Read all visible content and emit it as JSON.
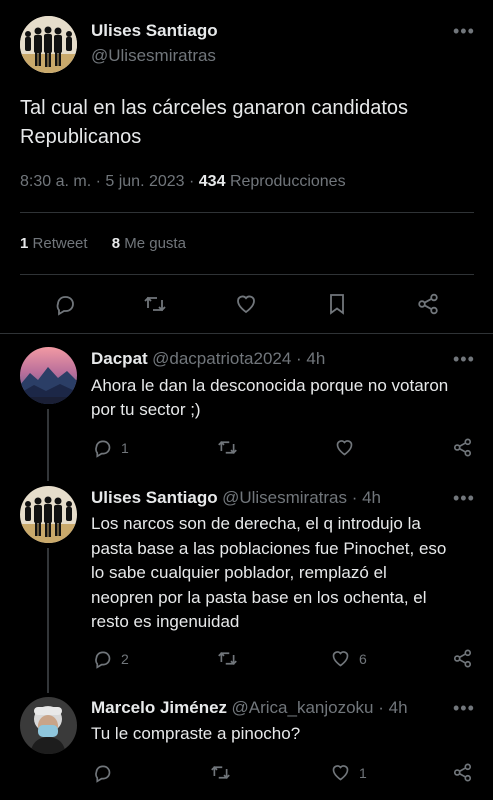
{
  "main_tweet": {
    "author_name": "Ulises Santiago",
    "author_handle": "@Ulisesmiratras",
    "text_line1": "Tal cual en las cárceles ganaron candidatos",
    "text_line2": "Republicanos",
    "time": "8:30 a. m. · 5 jun. 2023 ·",
    "views_count": "434",
    "views_label": "Reproducciones",
    "retweets_count": "1",
    "retweets_label": "Retweet",
    "likes_count": "8",
    "likes_label": "Me gusta"
  },
  "replies": [
    {
      "name": "Dacpat",
      "handle_time": "@dacpatriota2024 · 4h",
      "lines": [
        "Ahora le dan la desconocida porque no votaron",
        "por tu sector ;)"
      ],
      "reply_count": "1",
      "retweet_count": "",
      "like_count": ""
    },
    {
      "name": "Ulises Santiago",
      "handle_time": "@Ulisesmiratras · 4h",
      "lines": [
        "Los narcos son de derecha, el q introdujo la",
        "pasta base a las poblaciones fue Pinochet, eso",
        "lo sabe cualquier poblador, remplazó el",
        "neopren por la pasta base en los ochenta, el",
        "resto es ingenuidad"
      ],
      "reply_count": "2",
      "retweet_count": "",
      "like_count": "6"
    },
    {
      "name": "Marcelo Jiménez",
      "handle_time": "@Arica_kanjozoku · 4h",
      "lines": [
        "Tu le compraste a pinocho?"
      ],
      "reply_count": "",
      "retweet_count": "",
      "like_count": "1"
    }
  ],
  "icons": {
    "more": "more-dots-icon",
    "reply": "reply-icon",
    "retweet": "retweet-icon",
    "like": "heart-icon",
    "bookmark": "bookmark-icon",
    "share": "share-icon"
  },
  "colors": {
    "background": "#000000",
    "text": "#e7e9ea",
    "muted": "#71767b",
    "divider": "#2f3336"
  }
}
